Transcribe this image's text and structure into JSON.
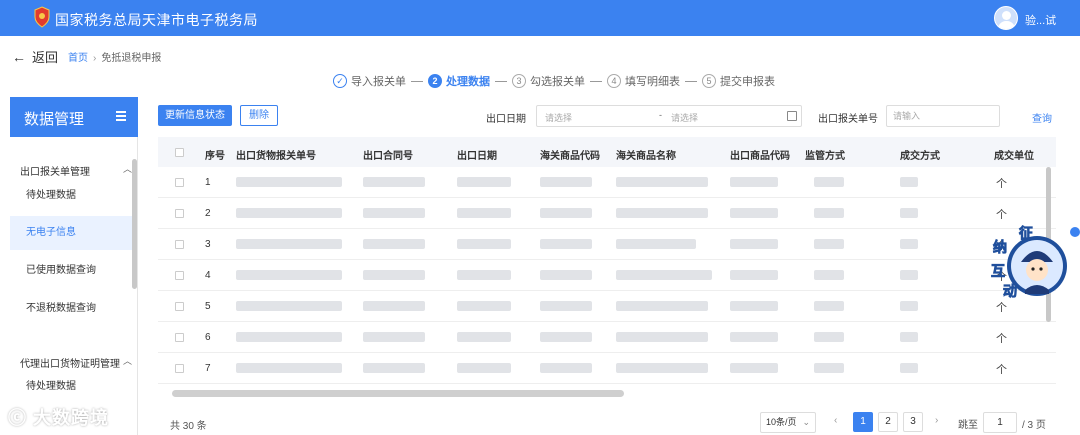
{
  "header": {
    "site_title": "国家税务总局天津市电子税务局",
    "user_name": "验...试",
    "brand_color": "#3b82f0"
  },
  "nav": {
    "back_label": "返回",
    "breadcrumb": {
      "home": "首页",
      "current": "免抵退税申报"
    }
  },
  "steps": [
    {
      "num": "1",
      "label": "导入报关单",
      "state": "done"
    },
    {
      "num": "2",
      "label": "处理数据",
      "state": "active"
    },
    {
      "num": "3",
      "label": "勾选报关单",
      "state": "pending"
    },
    {
      "num": "4",
      "label": "填写明细表",
      "state": "pending"
    },
    {
      "num": "5",
      "label": "提交申报表",
      "state": "pending"
    }
  ],
  "sidebar": {
    "title": "数据管理",
    "groups": [
      {
        "label": "出口报关单管理",
        "items": [
          "待处理数据",
          "无电子信息",
          "已使用数据查询",
          "不退税数据查询"
        ]
      },
      {
        "label": "代理出口货物证明管理",
        "items": [
          "待处理数据"
        ]
      }
    ],
    "active_item": "无电子信息"
  },
  "toolbar": {
    "update_button": "更新信息状态",
    "delete_button": "删除",
    "export_date_label": "出口日期",
    "date_start_placeholder": "请选择",
    "date_separator": "-",
    "date_end_placeholder": "请选择",
    "declaration_no_label": "出口报关单号",
    "declaration_no_placeholder": "请输入",
    "query_link": "查询"
  },
  "table": {
    "columns": [
      "序号",
      "出口货物报关单号",
      "出口合同号",
      "出口日期",
      "海关商品代码",
      "海关商品名称",
      "出口商品代码",
      "监管方式",
      "成交方式",
      "成交单位"
    ],
    "rows": [
      {
        "index": "1",
        "unit": "个"
      },
      {
        "index": "2",
        "unit": "个"
      },
      {
        "index": "3",
        "unit": "个"
      },
      {
        "index": "4",
        "unit": "个"
      },
      {
        "index": "5",
        "unit": "个"
      },
      {
        "index": "6",
        "unit": "个"
      },
      {
        "index": "7",
        "unit": "个"
      }
    ]
  },
  "pagination": {
    "total": "共 30 条",
    "page_size": "10条/页",
    "pages": [
      "1",
      "2",
      "3"
    ],
    "current_page": "1",
    "jump_label": "跳至",
    "jump_value": "1",
    "page_count_label": "/ 3 页"
  },
  "mascot": {
    "text": [
      "征",
      "纳",
      "互",
      "动"
    ]
  },
  "watermark": "大数跨境"
}
